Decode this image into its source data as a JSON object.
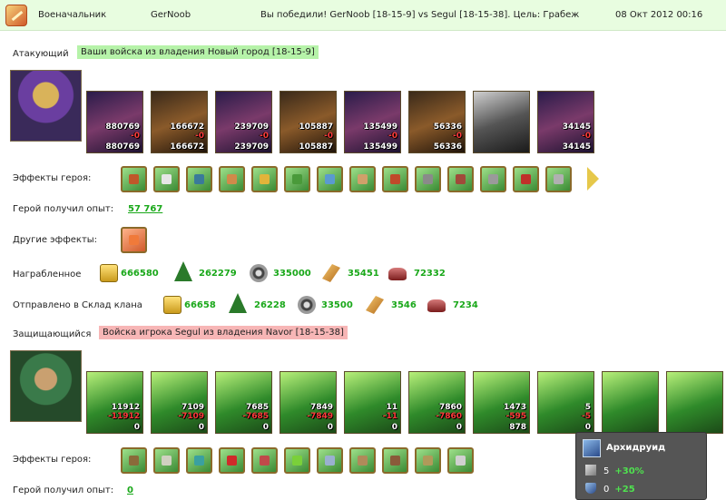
{
  "header": {
    "title": "Военачальник",
    "player": "GerNoob",
    "summary": "Вы победили! GerNoob [18-15-9] vs Segul [18-15-38]. Цель: Грабеж",
    "datetime": "08 Окт 2012 00:16"
  },
  "attacker": {
    "label": "Атакующий",
    "tag": "Ваши войска из владения Новый город [18-15-9]",
    "units": [
      {
        "start": "880769",
        "lost": "-0",
        "end": "880769"
      },
      {
        "start": "166672",
        "lost": "-0",
        "end": "166672"
      },
      {
        "start": "239709",
        "lost": "-0",
        "end": "239709"
      },
      {
        "start": "105887",
        "lost": "-0",
        "end": "105887"
      },
      {
        "start": "135499",
        "lost": "-0",
        "end": "135499"
      },
      {
        "start": "56336",
        "lost": "-0",
        "end": "56336"
      },
      {
        "start": "",
        "lost": "",
        "end": ""
      },
      {
        "start": "34145",
        "lost": "-0",
        "end": "34145"
      }
    ],
    "effects_label": "Эффекты героя:",
    "exp_label": "Герой получил опыт:",
    "exp_value": "57 767",
    "other_effects_label": "Другие эффекты:",
    "loot_label": "Награбленное",
    "loot": {
      "gold": "666580",
      "wood": "262279",
      "ore": "335000",
      "crystal": "35451",
      "gems": "72332"
    },
    "sent_label": "Отправлено в Склад клана",
    "sent": {
      "gold": "66658",
      "wood": "26228",
      "ore": "33500",
      "crystal": "3546",
      "gems": "7234"
    }
  },
  "defender": {
    "label": "Защищающийся",
    "tag": "Войска игрока Segul из владения Navor [18-15-38]",
    "units": [
      {
        "start": "11912",
        "lost": "-11912",
        "end": "0"
      },
      {
        "start": "7109",
        "lost": "-7109",
        "end": "0"
      },
      {
        "start": "7685",
        "lost": "-7685",
        "end": "0"
      },
      {
        "start": "7849",
        "lost": "-7849",
        "end": "0"
      },
      {
        "start": "11",
        "lost": "-11",
        "end": "0"
      },
      {
        "start": "7860",
        "lost": "-7860",
        "end": "0"
      },
      {
        "start": "1473",
        "lost": "-595",
        "end": "878"
      },
      {
        "start": "5",
        "lost": "-5",
        "end": "0"
      },
      {
        "start": "",
        "lost": "",
        "end": ""
      },
      {
        "start": "",
        "lost": "",
        "end": ""
      }
    ],
    "effects_label": "Эффекты героя:",
    "exp_label": "Герой получил опыт:",
    "exp_value": "0"
  },
  "tooltip": {
    "name": "Архидруид",
    "attack": "5",
    "attack_bonus": "+30%",
    "defense": "0",
    "defense_bonus": "+25"
  },
  "colors": {
    "header_bg": "#e8fde0",
    "green_tag": "#b6f3a9",
    "red_tag": "#f7b6b6",
    "gain": "#1aa81a",
    "loss": "#ff3b3b"
  }
}
